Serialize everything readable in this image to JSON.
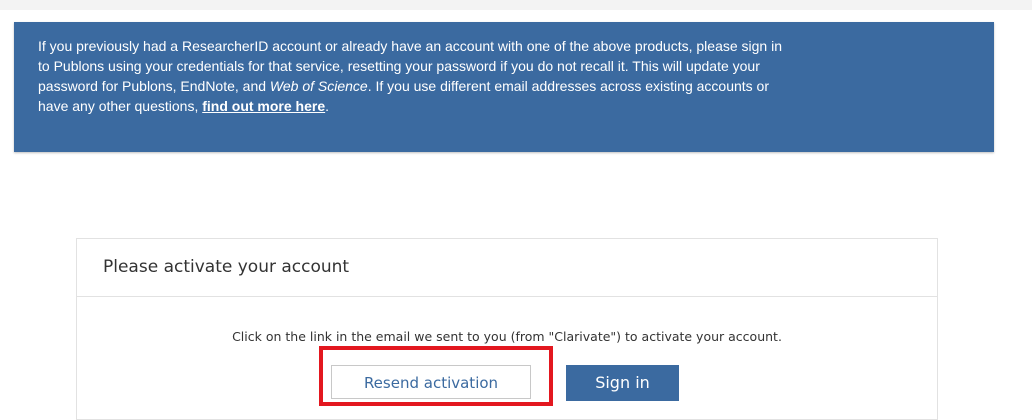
{
  "notice": {
    "line1": "If you previously had a ResearcherID account or already have an account with one of the above products, please sign in",
    "line2": "to Publons using your credentials for that service, resetting your password if you do not recall it. This will update your",
    "line3_prefix": "password for Publons, EndNote, and ",
    "line3_italic": "Web of Science",
    "line3_suffix": ". If you use different email addresses across existing accounts or",
    "line4_prefix": "have any other questions, ",
    "link_text": "find out more here",
    "line4_suffix": "."
  },
  "activation": {
    "title": "Please activate your account",
    "instruction": "Click on the link in the email we sent to you (from \"Clarivate\") to activate your account.",
    "resend_label": "Resend activation",
    "signin_label": "Sign in"
  },
  "colors": {
    "banner": "#3b6aa0",
    "highlight": "#e3171f"
  }
}
